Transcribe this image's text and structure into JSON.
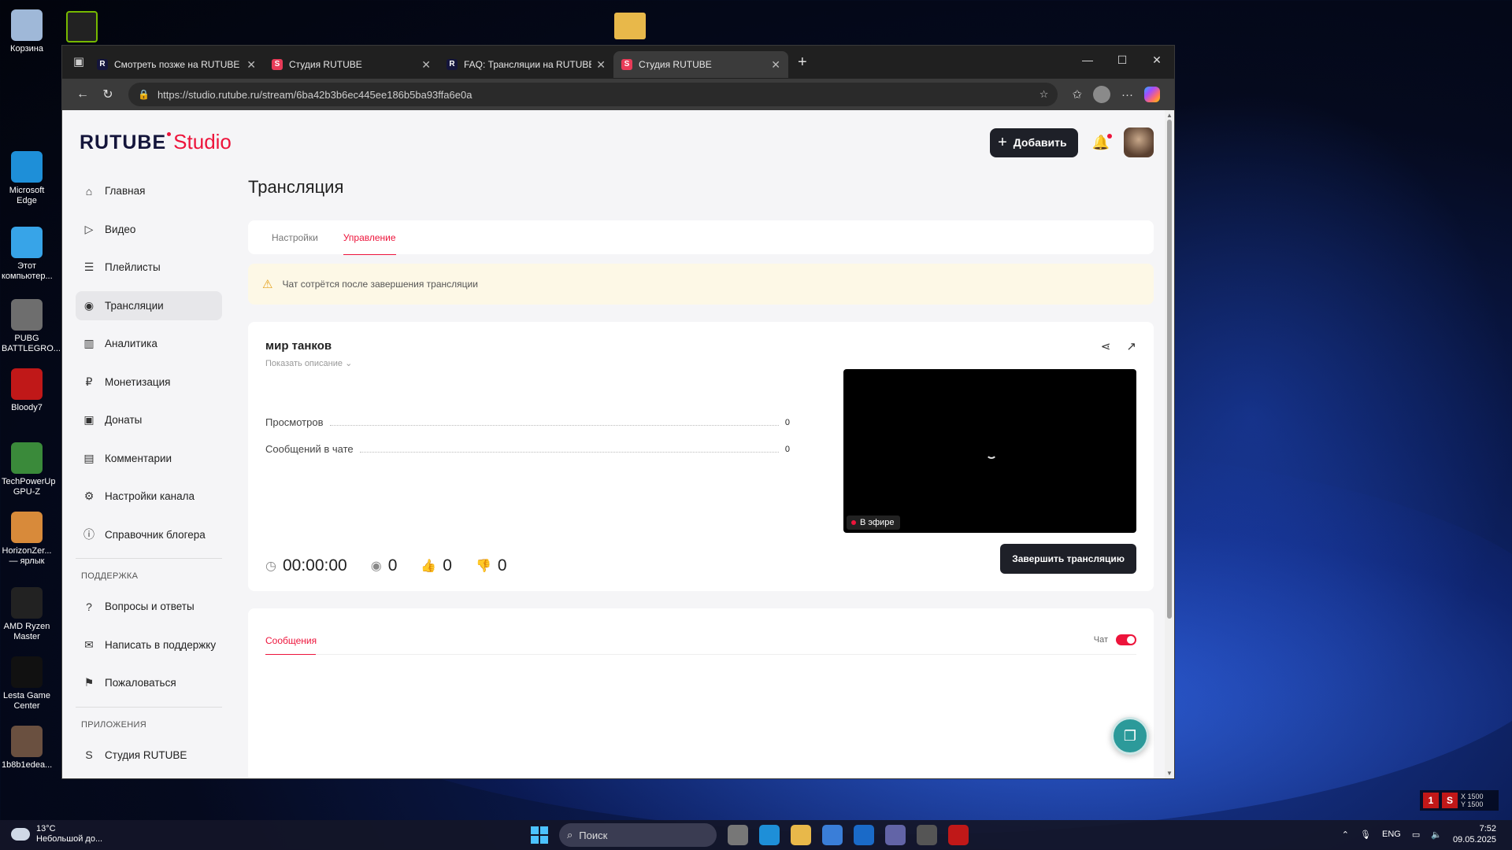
{
  "desktop": {
    "icons": [
      {
        "label": "Корзина",
        "color": "#9fb8d8"
      },
      {
        "label": "Microsoft Edge",
        "color": "#1e8fd8"
      },
      {
        "label": "Этот компьютер...",
        "color": "#37a4e8"
      },
      {
        "label": "PUBG BATTLEGRO...",
        "color": "#6e6e6e"
      },
      {
        "label": "Bloody7",
        "color": "#c01818"
      },
      {
        "label": "TechPowerUp GPU-Z",
        "color": "#3a8a3a"
      },
      {
        "label": "HorizonZer... — ярлык",
        "color": "#d88a3a"
      },
      {
        "label": "AMD Ryzen Master",
        "color": "#222222"
      },
      {
        "label": "Lesta Game Center",
        "color": "#111111"
      },
      {
        "label": "1b8b1edea...",
        "color": "#6a5040"
      }
    ]
  },
  "browser": {
    "tabs": [
      {
        "label": "Смотреть позже на RUTUBE",
        "favicon": "R",
        "active": false
      },
      {
        "label": "Студия RUTUBE",
        "favicon": "S",
        "active": false
      },
      {
        "label": "FAQ: Трансляции на RUTUBE",
        "favicon": "R",
        "active": false
      },
      {
        "label": "Студия RUTUBE",
        "favicon": "S",
        "active": true
      }
    ],
    "url": "https://studio.rutube.ru/stream/6ba42b3b6ec445ee186b5ba93ffa6e0a"
  },
  "header": {
    "logo_main": "RUTUBE",
    "logo_studio": "Studio",
    "add_label": "Добавить"
  },
  "sidebar": {
    "items": [
      {
        "label": "Главная",
        "icon": "home-icon"
      },
      {
        "label": "Видео",
        "icon": "video-icon"
      },
      {
        "label": "Плейлисты",
        "icon": "playlist-icon"
      },
      {
        "label": "Трансляции",
        "icon": "broadcast-icon",
        "active": true
      },
      {
        "label": "Аналитика",
        "icon": "analytics-icon"
      },
      {
        "label": "Монетизация",
        "icon": "ruble-icon"
      },
      {
        "label": "Донаты",
        "icon": "wallet-icon"
      },
      {
        "label": "Комментарии",
        "icon": "comment-icon"
      },
      {
        "label": "Настройки канала",
        "icon": "gear-icon"
      },
      {
        "label": "Справочник блогера",
        "icon": "info-icon"
      }
    ],
    "support_heading": "ПОДДЕРЖКА",
    "support_items": [
      {
        "label": "Вопросы и ответы",
        "icon": "question-icon"
      },
      {
        "label": "Написать в поддержку",
        "icon": "mail-icon"
      },
      {
        "label": "Пожаловаться",
        "icon": "flag-icon"
      }
    ],
    "apps_heading": "ПРИЛОЖЕНИЯ",
    "apps_items": [
      {
        "label": "Студия RUTUBE",
        "icon": "studio-app-icon"
      }
    ]
  },
  "main": {
    "title": "Трансляция",
    "tabs": [
      {
        "label": "Настройки",
        "active": false
      },
      {
        "label": "Управление",
        "active": true
      }
    ],
    "warning": "Чат сотрётся после завершения трансляции",
    "stream": {
      "title": "мир танков",
      "show_description": "Показать описание",
      "stats": [
        {
          "label": "Просмотров",
          "value": "0"
        },
        {
          "label": "Сообщений в чате",
          "value": "0"
        }
      ],
      "live_badge": "В эфире",
      "timer": "00:00:00",
      "viewers": "0",
      "likes": "0",
      "dislikes": "0",
      "end_button": "Завершить трансляцию"
    },
    "chat": {
      "tab_label": "Сообщения",
      "toggle_label": "Чат",
      "toggle_on": true
    }
  },
  "taskbar": {
    "weather_temp": "13°C",
    "weather_desc": "Небольшой до...",
    "search_placeholder": "Поиск",
    "lang": "ENG",
    "time": "7:52",
    "date": "09.05.2025"
  },
  "overlay": {
    "line1": "X 1500",
    "line2": "Y 1500"
  }
}
